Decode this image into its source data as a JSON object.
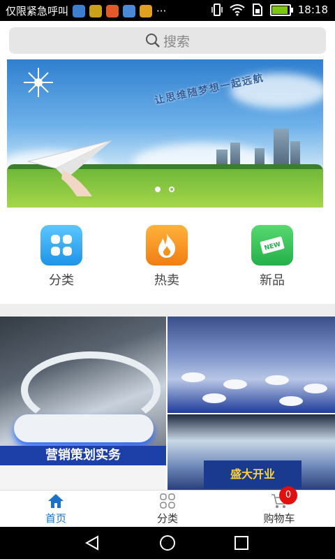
{
  "status": {
    "carrier": "仅限紧急呼叫",
    "time": "18:18",
    "more": "···",
    "battery_level": 0.85
  },
  "search": {
    "placeholder": "搜索"
  },
  "banner": {
    "slogan": "让思维随梦想一起远航",
    "slides": 2,
    "active_slide": 0
  },
  "categories": [
    {
      "label": "分类",
      "icon": "grid-icon",
      "color": "#2ea8f0"
    },
    {
      "label": "热卖",
      "icon": "flame-icon",
      "color": "#f4961e"
    },
    {
      "label": "新品",
      "icon": "new-tag-icon",
      "color": "#3cc25a"
    }
  ],
  "promos": {
    "tile1_caption": "营销策划实务",
    "tile3_sign": "盛大开业"
  },
  "tabbar": {
    "items": [
      {
        "label": "首页",
        "icon": "home-icon",
        "active": true
      },
      {
        "label": "分类",
        "icon": "category-icon",
        "active": false
      },
      {
        "label": "购物车",
        "icon": "cart-icon",
        "active": false
      }
    ],
    "cart_badge": "0"
  },
  "colors": {
    "accent": "#1a73c8",
    "badge": "#e01010"
  }
}
